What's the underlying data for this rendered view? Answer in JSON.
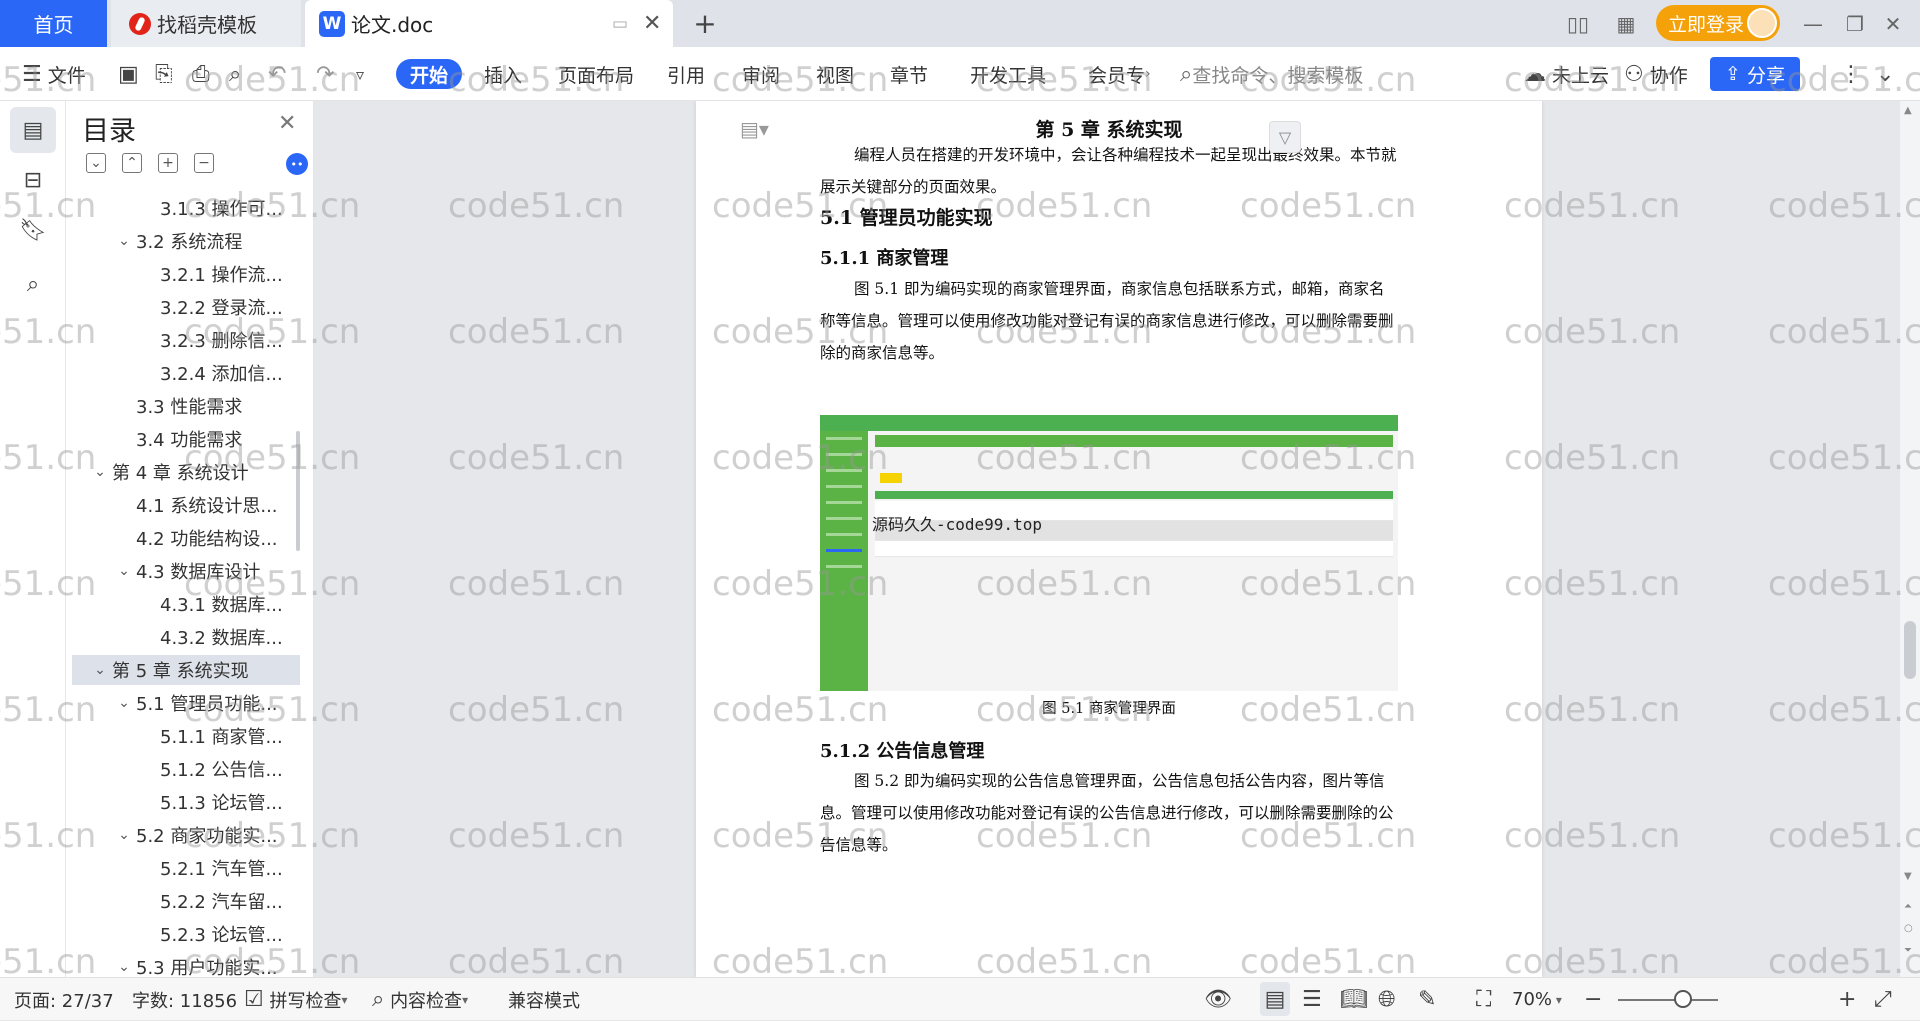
{
  "tabs": {
    "home": "首页",
    "template": "找稻壳模板",
    "doc": "论文.doc",
    "add": "+"
  },
  "top_right": {
    "login": "立即登录"
  },
  "menu": {
    "file": "文件",
    "start": "开始",
    "insert": "插入",
    "layout": "页面布局",
    "reference": "引用",
    "review": "审阅",
    "view": "视图",
    "chapter": "章节",
    "devtools": "开发工具",
    "member": "会员专",
    "search_placeholder": "查找命令、搜索模板",
    "cloud": "未上云",
    "collab": "协作",
    "share": "分享"
  },
  "toc": {
    "title": "目录",
    "items": [
      {
        "level": 2,
        "text": "3.1.3  操作可..."
      },
      {
        "level": 1,
        "text": "3.2  系统流程",
        "expand": true
      },
      {
        "level": 2,
        "text": "3.2.1  操作流..."
      },
      {
        "level": 2,
        "text": "3.2.2  登录流..."
      },
      {
        "level": 2,
        "text": "3.2.3  删除信..."
      },
      {
        "level": 2,
        "text": "3.2.4  添加信..."
      },
      {
        "level": 1,
        "text": "3.3  性能需求"
      },
      {
        "level": 1,
        "text": "3.4  功能需求"
      },
      {
        "level": 0,
        "text": "第 4 章  系统设计",
        "expand": true
      },
      {
        "level": 1,
        "text": "4.1  系统设计思..."
      },
      {
        "level": 1,
        "text": "4.2  功能结构设..."
      },
      {
        "level": 1,
        "text": "4.3  数据库设计",
        "expand": true
      },
      {
        "level": 2,
        "text": "4.3.1  数据库..."
      },
      {
        "level": 2,
        "text": "4.3.2  数据库..."
      },
      {
        "level": 0,
        "text": "第 5 章  系统实现",
        "expand": true,
        "selected": true
      },
      {
        "level": 1,
        "text": "5.1  管理员功能...",
        "expand": true
      },
      {
        "level": 2,
        "text": "5.1.1  商家管..."
      },
      {
        "level": 2,
        "text": "5.1.2  公告信..."
      },
      {
        "level": 2,
        "text": "5.1.3  论坛管..."
      },
      {
        "level": 1,
        "text": "5.2  商家功能实...",
        "expand": true
      },
      {
        "level": 2,
        "text": "5.2.1  汽车管..."
      },
      {
        "level": 2,
        "text": "5.2.2  汽车留..."
      },
      {
        "level": 2,
        "text": "5.2.3  论坛管..."
      },
      {
        "level": 1,
        "text": "5.3  用户功能实...",
        "expand": true
      }
    ]
  },
  "document": {
    "chapter_title": "第 5 章  系统实现",
    "intro": "编程人员在搭建的开发环境中，会让各种编程技术一起呈现出最终效果。本节就展示关键部分的页面效果。",
    "section": "5.1  管理员功能实现",
    "sub1": "5.1.1  商家管理",
    "para1": "图 5.1  即为编码实现的商家管理界面，商家信息包括联系方式，邮箱，商家名称等信息。管理可以使用修改功能对登记有误的商家信息进行修改，可以删除需要删除的商家信息等。",
    "figure_overlay": "源码久久-code99.top",
    "caption1": "图 5.1  商家管理界面",
    "sub2": "5.1.2  公告信息管理",
    "para2": "图 5.2  即为编码实现的公告信息管理界面，公告信息包括公告内容，图片等信息。管理可以使用修改功能对登记有误的公告信息进行修改，可以删除需要删除的公告信息等。"
  },
  "status": {
    "page": "页面: 27/37",
    "words": "字数: 11856",
    "spell": "拼写检查",
    "content_check": "内容检查",
    "compat": "兼容模式",
    "zoom": "70%"
  },
  "watermark": "code51.cn",
  "colors": {
    "accent": "#2b67f6",
    "login": "#f5a20a",
    "figure_green": "#4caf50"
  }
}
